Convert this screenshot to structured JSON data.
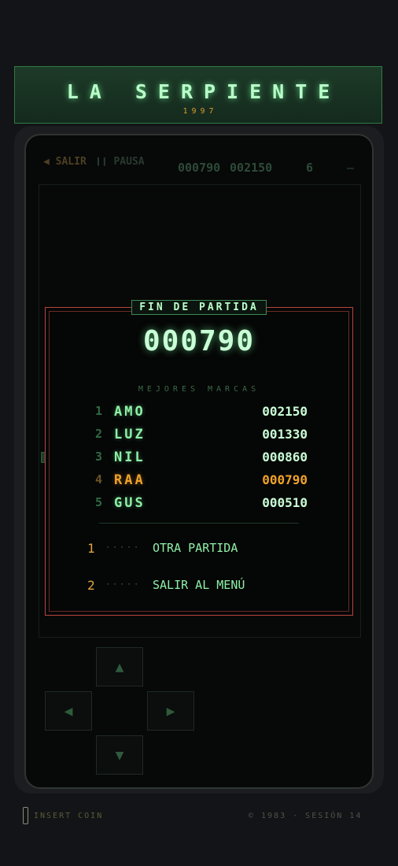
{
  "banner": {
    "title": "LA SERPIENTE",
    "subtitle": "1997"
  },
  "hud": {
    "exit_label": "◀ SALIR",
    "pause_label": "❙❙ PAUSA",
    "score": "000790",
    "best": "002150",
    "level": "6",
    "lives": "—"
  },
  "game_over": {
    "title": "FIN DE PARTIDA",
    "final_score": "000790",
    "highscores_title": "MEJORES MARCAS",
    "highscores": [
      {
        "rank": "1",
        "name": "AMO",
        "score": "002150",
        "current": false
      },
      {
        "rank": "2",
        "name": "LUZ",
        "score": "001330",
        "current": false
      },
      {
        "rank": "3",
        "name": "NIL",
        "score": "000860",
        "current": false
      },
      {
        "rank": "4",
        "name": "RAA",
        "score": "000790",
        "current": true
      },
      {
        "rank": "5",
        "name": "GUS",
        "score": "000510",
        "current": false
      }
    ],
    "options": [
      {
        "key": "1",
        "dots": "·····",
        "label": "OTRA PARTIDA"
      },
      {
        "key": "2",
        "dots": "·····",
        "label": "SALIR AL MENÚ"
      }
    ]
  },
  "controls": {
    "up": "▲",
    "left": "◀",
    "right": "▶",
    "down": "▼"
  },
  "footer": {
    "insert_coin": "INSERT COIN",
    "copyright": "© 1983  ·  SESIÓN 14"
  },
  "colors": {
    "phosphor": "#8ef0a6",
    "amber": "#f0a22a",
    "frame": "#b8463f"
  }
}
